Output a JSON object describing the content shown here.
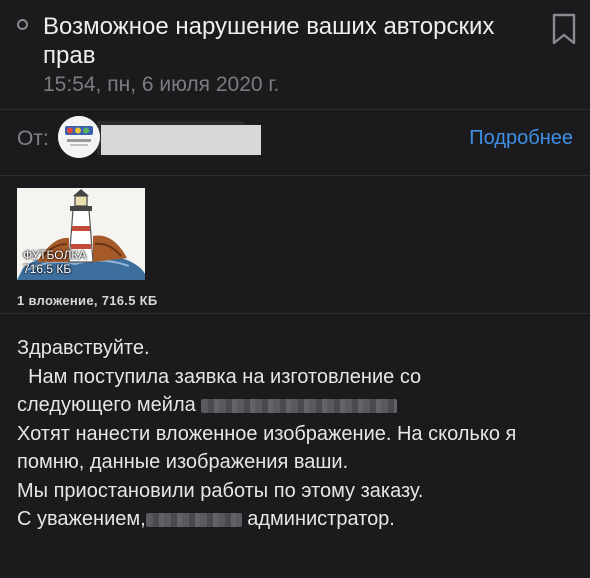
{
  "email": {
    "subject": "Возможное нарушение ваших авторских прав",
    "date": "15:54, пн, 6 июля 2020 г.",
    "from_label": "От:",
    "details_link": "Подробнее",
    "attachment": {
      "name": "ФУТБОЛКА",
      "size": "716.5 КБ",
      "summary": "1 вложение, 716.5 КБ"
    },
    "body": {
      "line1": "Здравствуйте.",
      "line2": "  Нам поступила заявка на изготовление со",
      "line3": "следующего мейла ",
      "line4": "Хотят нанести вложенное изображение. На сколько я",
      "line5": "помню, данные изображения ваши.",
      "line6": "Мы приостановили работы по этому заказу.",
      "line7_a": "С уважением,",
      "line7_b": " администратор."
    }
  },
  "icons": {
    "unread": "circle-outline-icon",
    "bookmark": "bookmark-icon"
  },
  "colors": {
    "background": "#1b1b1d",
    "link": "#3f8fe6",
    "muted": "#7c7c80"
  }
}
